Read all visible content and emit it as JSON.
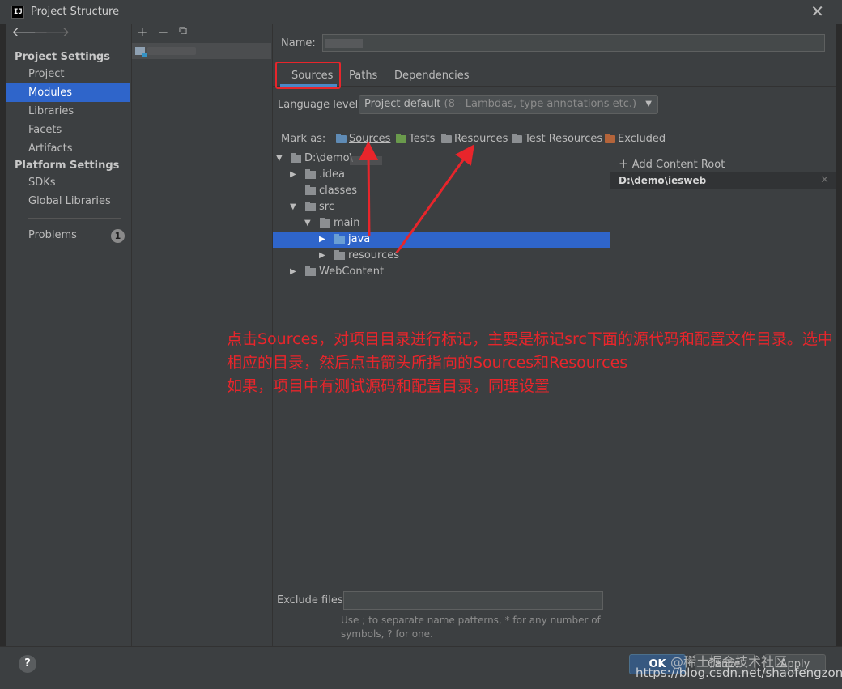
{
  "window": {
    "title": "Project Structure",
    "app_icon": "IJ"
  },
  "sidebar": {
    "project_settings_header": "Project Settings",
    "project_items": [
      "Project",
      "Modules",
      "Libraries",
      "Facets",
      "Artifacts"
    ],
    "active_item": "Modules",
    "platform_settings_header": "Platform Settings",
    "platform_items": [
      "SDKs",
      "Global Libraries"
    ],
    "problems_label": "Problems",
    "problems_count": "1"
  },
  "module_toolbar": {
    "add": "+",
    "remove": "−",
    "copy": "⧉"
  },
  "main": {
    "name_label": "Name:",
    "tabs": [
      "Sources",
      "Paths",
      "Dependencies"
    ],
    "active_tab": "Sources",
    "language_level_label": "Language level:",
    "language_level_value": "Project default",
    "language_level_detail": " (8 - Lambdas, type annotations etc.)",
    "mark_as_label": "Mark as:",
    "mark_as_buttons": [
      {
        "label": "Sources",
        "color": "#5f8bb5"
      },
      {
        "label": "Tests",
        "color": "#6a9a4c"
      },
      {
        "label": "Resources",
        "color": "#8c8f92"
      },
      {
        "label": "Test Resources",
        "color": "#8c8f92"
      },
      {
        "label": "Excluded",
        "color": "#b4643a"
      }
    ],
    "tree": [
      {
        "label": "D:\\demo\\",
        "expanded": true
      },
      {
        "label": ".idea",
        "expanded": false
      },
      {
        "label": "classes"
      },
      {
        "label": "src",
        "expanded": true
      },
      {
        "label": "main",
        "expanded": true
      },
      {
        "label": "java",
        "expanded": false,
        "selected": true
      },
      {
        "label": "resources",
        "expanded": false
      },
      {
        "label": "WebContent",
        "expanded": false
      }
    ],
    "add_content_root": "Add Content Root",
    "content_root": "D:\\demo\\iesweb",
    "exclude_files_label": "Exclude files:",
    "exclude_files_value": "",
    "exclude_hint": "Use ; to separate name patterns, * for any number of symbols, ? for one."
  },
  "annotation": {
    "line1": "点击Sources，对项目目录进行标记，主要是标记src下面的源代码和配置文件目录。选中相应的目录，然后点击箭头所指向的Sources和Resources",
    "line2": "如果，项目中有测试源码和配置目录，同理设置",
    "color": "#e8252b"
  },
  "footer": {
    "help": "?",
    "ok": "OK",
    "cancel": "Cancel",
    "apply": "Apply",
    "watermark1": "@稀土掘金技术社区",
    "watermark2": "https://blog.csdn.net/shaofengzong"
  }
}
